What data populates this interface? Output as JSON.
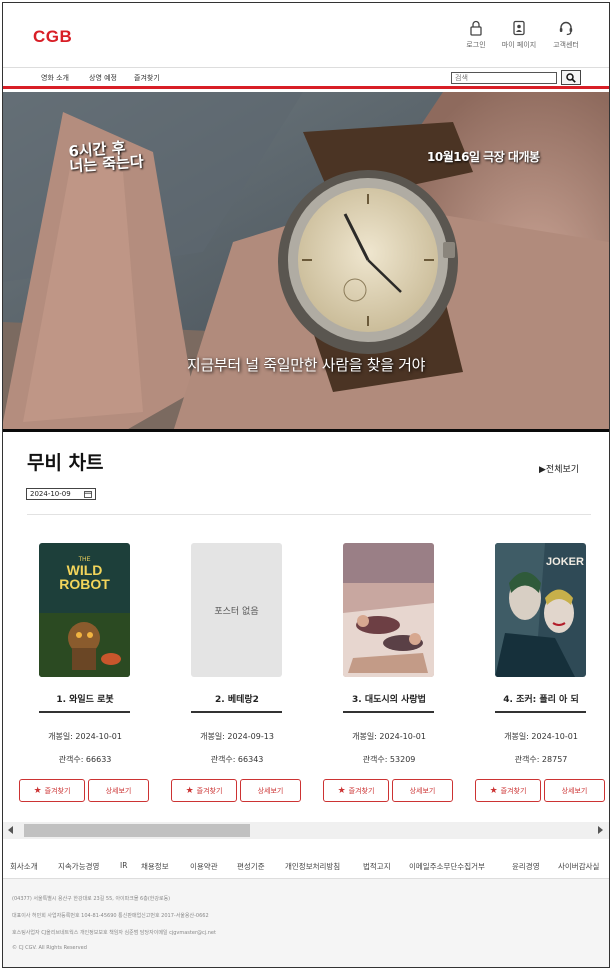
{
  "header": {
    "logo": "CGB",
    "utils": [
      {
        "label": "로그인",
        "icon": "lock-icon"
      },
      {
        "label": "마이 페이지",
        "icon": "person-icon"
      },
      {
        "label": "고객센터",
        "icon": "headset-icon"
      }
    ]
  },
  "nav": {
    "items": [
      "영화 소개",
      "상영 예정",
      "즐겨찾기"
    ],
    "search_placeholder": "검색",
    "search_icon": "search-icon"
  },
  "hero": {
    "title": "6시간 후\n너는 죽는다",
    "release": "10월16일 극장 대개봉",
    "caption": "지금부터 널 죽일만한 사람을 찾을 거야"
  },
  "chart": {
    "title": "무비 차트",
    "view_all": "▶전체보기",
    "date": "2024-10-09",
    "movies": [
      {
        "name": "1. 와일드 로봇",
        "open": "개봉일: 2024-10-01",
        "audience": "관객수: 66633",
        "poster_label": ""
      },
      {
        "name": "2. 베테랑2",
        "open": "개봉일: 2024-09-13",
        "audience": "관객수: 66343",
        "poster_label": "포스터 없음"
      },
      {
        "name": "3. 대도시의 사랑법",
        "open": "개봉일: 2024-10-01",
        "audience": "관객수: 53209",
        "poster_label": ""
      },
      {
        "name": "4. 조커: 폴리 아 되",
        "open": "개봉일: 2024-10-01",
        "audience": "관객수: 28757",
        "poster_label": ""
      }
    ],
    "fav_label": "즐겨찾기",
    "detail_label": "상세보기"
  },
  "posters": {
    "wild_robot_text": "THE WILD ROBOT",
    "joker_text": "JOKER"
  },
  "footer": {
    "links": [
      "회사소개",
      "지속가능경영",
      "IR",
      "채용정보",
      "이용약관",
      "편성기준",
      "개인정보처리방침",
      "법적고지",
      "이메일주소무단수집거부",
      "윤리경영",
      "사이버감사실"
    ],
    "info": [
      "(04377) 서울특별시 용산구 한강대로 23길 55, 아이파크몰 6층(한강로동)",
      "대표이사 허민회 사업자등록번호 104-81-45690 통신판매업신고번호 2017-서울용산-0662",
      "호스팅사업자 CJ올리브네트웍스 개인정보보호 책임자 심준범 담당자이메일 cjgvmaster@cj.net",
      "© CJ CGV. All Rights Reserved"
    ]
  },
  "colors": {
    "brand": "#d81e26",
    "button_border": "#cc3333"
  }
}
